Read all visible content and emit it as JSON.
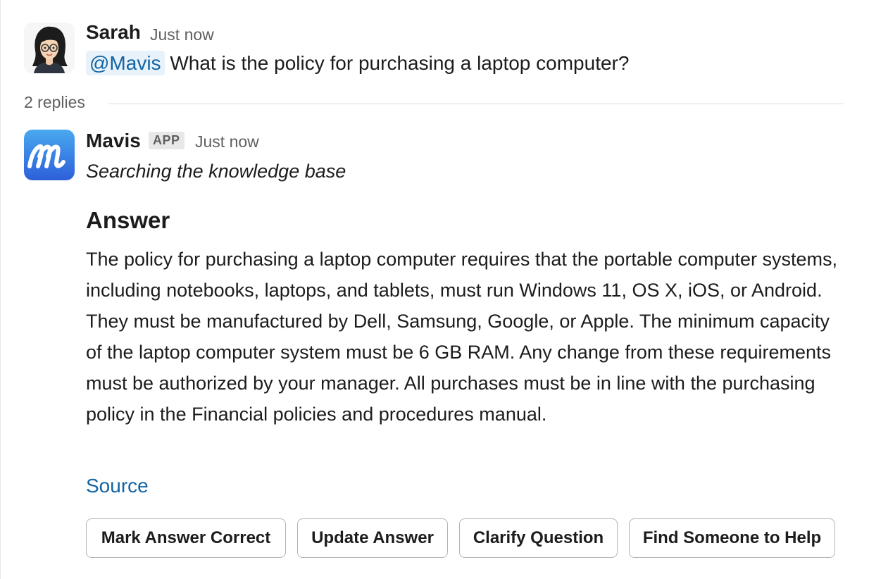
{
  "thread": {
    "question": {
      "sender": "Sarah",
      "time": "Just now",
      "mention": "@Mavis",
      "text": " What is the policy for purchasing a laptop computer?"
    },
    "replies_label": "2 replies",
    "reply": {
      "sender": "Mavis",
      "badge": "APP",
      "time": "Just now",
      "status": "Searching the knowledge base",
      "answer_heading": "Answer",
      "answer_text": "The policy for purchasing a laptop computer requires that the portable computer systems, including notebooks, laptops, and tablets, must run Windows 11, OS X, iOS, or Android. They must be manufactured by Dell, Samsung, Google, or Apple. The minimum capacity of the laptop computer system must be 6 GB RAM. Any change from these requirements must be authorized by your manager. All purchases must be in line with the purchasing policy in the Financial policies and procedures manual.",
      "source_label": "Source",
      "buttons": [
        {
          "label": "Mark Answer Correct"
        },
        {
          "label": "Update Answer"
        },
        {
          "label": "Clarify Question"
        },
        {
          "label": "Find Someone to Help"
        }
      ]
    }
  },
  "colors": {
    "link": "#1264a3",
    "mention_bg": "#e8f2fa",
    "app_logo_gradient_top": "#49a9f0",
    "app_logo_gradient_bottom": "#2d5fd9"
  },
  "icons": {
    "sarah_avatar": "user-avatar-icon",
    "mavis_avatar": "mavis-app-logo-icon"
  }
}
